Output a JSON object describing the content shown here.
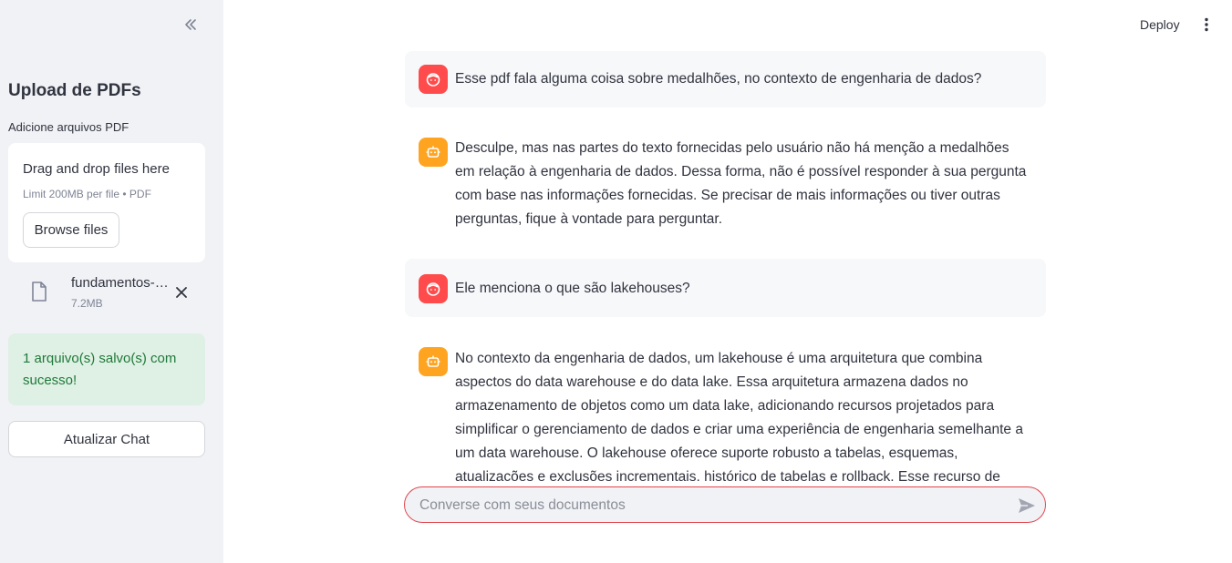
{
  "sidebar": {
    "title": "Upload de PDFs",
    "uploader_label": "Adicione arquivos PDF",
    "dropzone": {
      "title": "Drag and drop files here",
      "limit": "Limit 200MB per file • PDF",
      "browse_label": "Browse files"
    },
    "file": {
      "name": "fundamentos-…",
      "size": "7.2MB"
    },
    "success_message": "1 arquivo(s) salvo(s) com sucesso!",
    "refresh_label": "Atualizar Chat"
  },
  "header": {
    "deploy_label": "Deploy"
  },
  "messages": [
    {
      "role": "user",
      "text": "Esse pdf fala alguma coisa sobre medalhões, no contexto de engenharia de dados?"
    },
    {
      "role": "assistant",
      "text": "Desculpe, mas nas partes do texto fornecidas pelo usuário não há menção a medalhões em relação à engenharia de dados. Dessa forma, não é possível responder à sua pergunta com base nas informações fornecidas. Se precisar de mais informações ou tiver outras perguntas, fique à vontade para perguntar."
    },
    {
      "role": "user",
      "text": "Ele menciona o que são lakehouses?"
    },
    {
      "role": "assistant",
      "text": "No contexto da engenharia de dados, um lakehouse é uma arquitetura que combina aspectos do data warehouse e do data lake. Essa arquitetura armazena dados no armazenamento de objetos como um data lake, adicionando recursos projetados para simplificar o gerenciamento de dados e criar uma experiência de engenharia semelhante a um data warehouse. O lakehouse oferece suporte robusto a tabelas, esquemas, atualizações e exclusões incrementais, histórico de tabelas e rollback. Esse recurso de lakehouse é ...mais dados e auto desenvolvimento do projeto"
    }
  ],
  "chat_input": {
    "placeholder": "Converse com seus documentos"
  },
  "colors": {
    "user_avatar": "#ff4b4b",
    "assistant_avatar": "#ffa421",
    "success_bg": "#dff0e4",
    "success_text": "#1f7a3a",
    "input_border": "#e0474f"
  },
  "icons": {
    "collapse": "double-chevron-left-icon",
    "file": "file-icon",
    "remove": "close-icon",
    "menu": "more-vertical-icon",
    "user_avatar": "face-icon",
    "assistant_avatar": "robot-icon",
    "send": "send-icon"
  }
}
